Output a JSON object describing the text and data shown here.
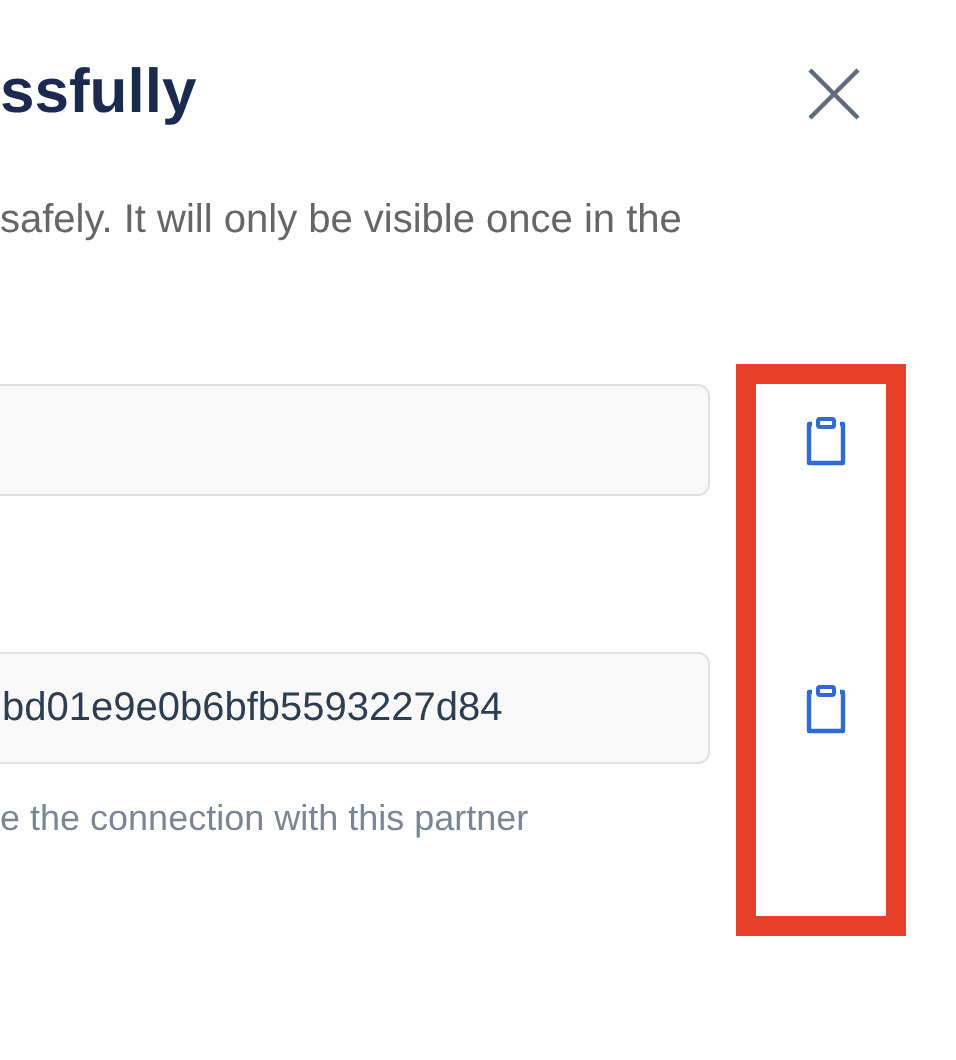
{
  "dialog": {
    "title": "ssfully",
    "description": "safely. It will only be visible once in the",
    "fields": [
      {
        "copy_button": true
      },
      {
        "value": "bd01e9e0b6bfb5593227d84",
        "copy_button": true,
        "helper": "e the connection with this partner"
      }
    ],
    "highlight": true
  }
}
